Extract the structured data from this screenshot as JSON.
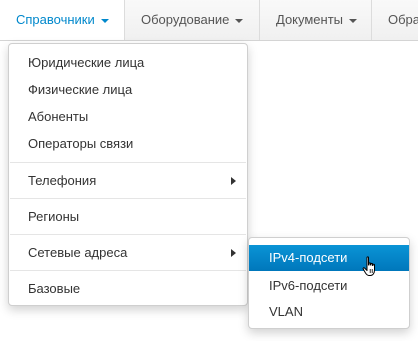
{
  "navbar": {
    "items": [
      {
        "label": "Справочники"
      },
      {
        "label": "Оборудование"
      },
      {
        "label": "Документы"
      },
      {
        "label": "Обра"
      }
    ]
  },
  "dropdown": {
    "items": [
      "Юридические лица",
      "Физические лица",
      "Абоненты",
      "Операторы связи",
      "Телефония",
      "Регионы",
      "Сетевые адреса",
      "Базовые"
    ]
  },
  "submenu": {
    "items": [
      "IPv4-подсети",
      "IPv6-подсети",
      "VLAN"
    ]
  },
  "colors": {
    "accent": "#0088cc",
    "highlight": "#0081c2"
  },
  "icons": {
    "caret": "caret-down-icon",
    "submenu_arrow": "chevron-right-icon",
    "cursor": "hand-pointer-icon"
  }
}
